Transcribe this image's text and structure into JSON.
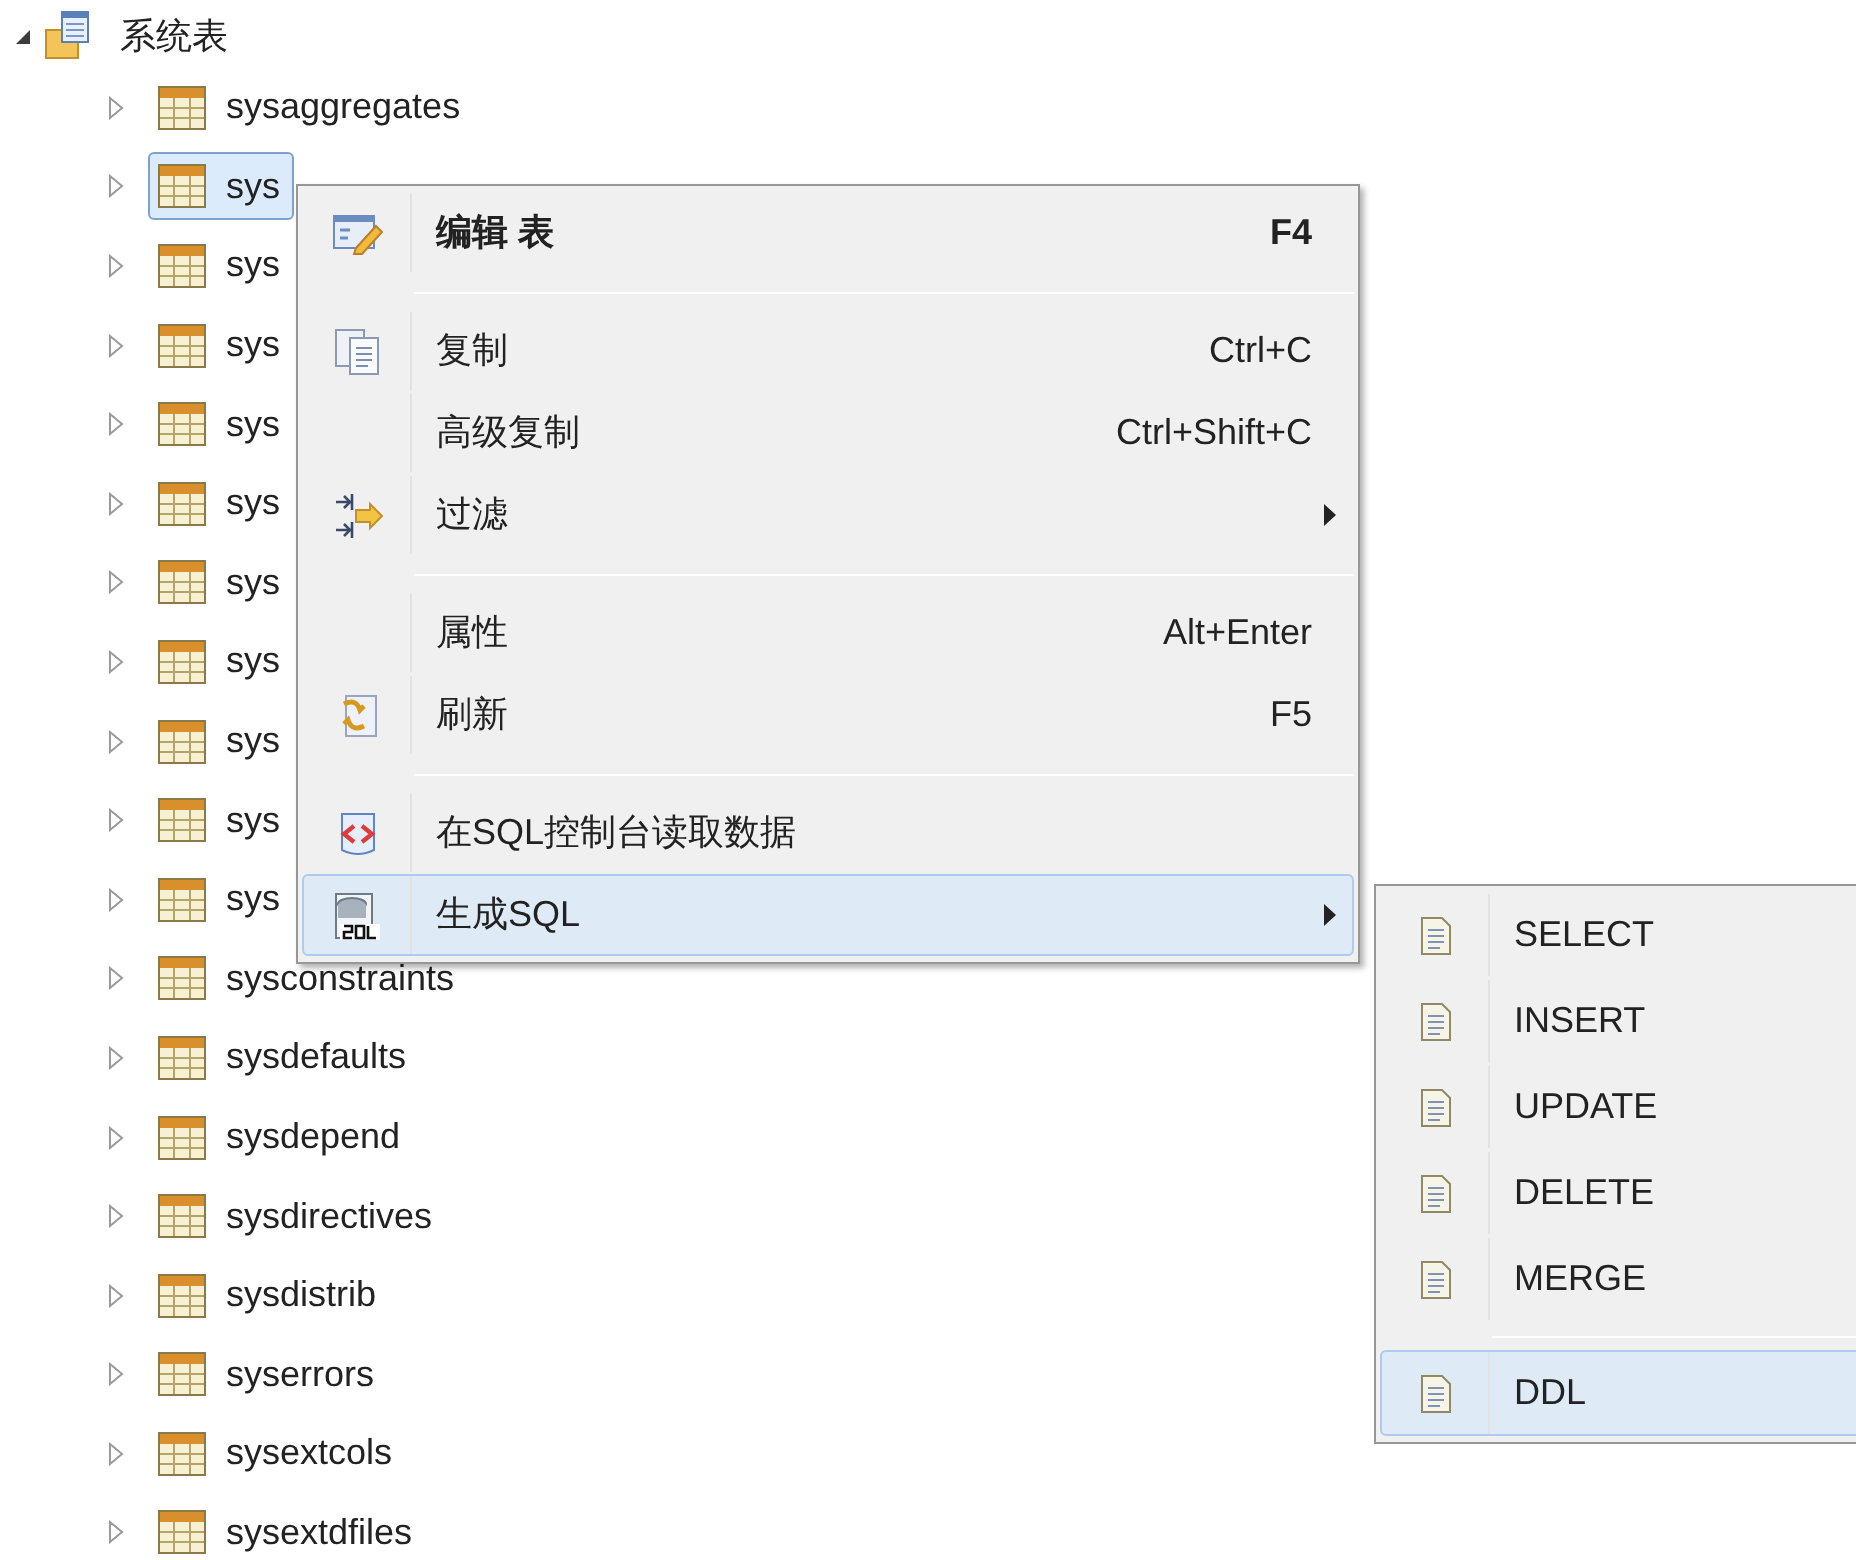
{
  "tree": {
    "label": "系统表",
    "expanded": true,
    "children": [
      {
        "label": "sysaggregates",
        "expanded": false,
        "selected": false
      },
      {
        "label": "sys",
        "expanded": false,
        "selected": true
      },
      {
        "label": "sys",
        "expanded": false,
        "selected": false
      },
      {
        "label": "sys",
        "expanded": false,
        "selected": false
      },
      {
        "label": "sys",
        "expanded": false,
        "selected": false
      },
      {
        "label": "sys",
        "expanded": false,
        "selected": false
      },
      {
        "label": "sys",
        "expanded": false,
        "selected": false
      },
      {
        "label": "sys",
        "expanded": false,
        "selected": false
      },
      {
        "label": "sys",
        "expanded": false,
        "selected": false
      },
      {
        "label": "sys",
        "expanded": false,
        "selected": false
      },
      {
        "label": "sys",
        "expanded": false,
        "selected": false
      },
      {
        "label": "sysconstraints",
        "expanded": false,
        "selected": false
      },
      {
        "label": "sysdefaults",
        "expanded": false,
        "selected": false
      },
      {
        "label": "sysdepend",
        "expanded": false,
        "selected": false
      },
      {
        "label": "sysdirectives",
        "expanded": false,
        "selected": false
      },
      {
        "label": "sysdistrib",
        "expanded": false,
        "selected": false
      },
      {
        "label": "syserrors",
        "expanded": false,
        "selected": false
      },
      {
        "label": "sysextcols",
        "expanded": false,
        "selected": false
      },
      {
        "label": "sysextdfiles",
        "expanded": false,
        "selected": false
      }
    ]
  },
  "context_menu": {
    "items": [
      {
        "kind": "item",
        "label": "编辑 表",
        "shortcut": "F4",
        "bold": true,
        "selected": false,
        "submenu": false
      },
      {
        "kind": "separator"
      },
      {
        "kind": "item",
        "label": "复制",
        "shortcut": "Ctrl+C",
        "bold": false,
        "selected": false,
        "submenu": false
      },
      {
        "kind": "item",
        "label": "高级复制",
        "shortcut": "Ctrl+Shift+C",
        "bold": false,
        "selected": false,
        "submenu": false
      },
      {
        "kind": "item",
        "label": "过滤",
        "bold": false,
        "selected": false,
        "submenu": true
      },
      {
        "kind": "separator"
      },
      {
        "kind": "item",
        "label": "属性",
        "shortcut": "Alt+Enter",
        "bold": false,
        "selected": false,
        "submenu": false
      },
      {
        "kind": "item",
        "label": "刷新",
        "shortcut": "F5",
        "bold": false,
        "selected": false,
        "submenu": false
      },
      {
        "kind": "separator"
      },
      {
        "kind": "item",
        "label": "在SQL控制台读取数据",
        "bold": false,
        "selected": false,
        "submenu": false
      },
      {
        "kind": "item",
        "label": "生成SQL",
        "bold": false,
        "selected": true,
        "submenu": true
      }
    ]
  },
  "submenu": {
    "items": [
      {
        "kind": "item",
        "label": "SELECT",
        "selected": false
      },
      {
        "kind": "item",
        "label": "INSERT",
        "selected": false
      },
      {
        "kind": "item",
        "label": "UPDATE",
        "selected": false
      },
      {
        "kind": "item",
        "label": "DELETE",
        "selected": false
      },
      {
        "kind": "item",
        "label": "MERGE",
        "selected": false
      },
      {
        "kind": "separator"
      },
      {
        "kind": "item",
        "label": "DDL",
        "selected": true
      }
    ]
  }
}
